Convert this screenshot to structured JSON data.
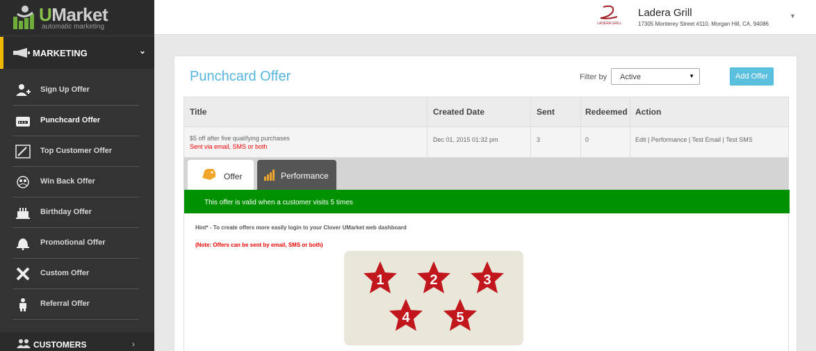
{
  "brand": {
    "letter": "U",
    "rest": "Market",
    "tagline": "automatic marketing"
  },
  "sidebar": {
    "section_label": "MARKETING",
    "items": [
      {
        "label": "Sign Up Offer",
        "icon": "add-user-icon"
      },
      {
        "label": "Punchcard Offer",
        "icon": "punchcard-icon"
      },
      {
        "label": "Top Customer Offer",
        "icon": "chart-icon"
      },
      {
        "label": "Win Back Offer",
        "icon": "group-icon"
      },
      {
        "label": "Birthday Offer",
        "icon": "cake-icon"
      },
      {
        "label": "Promotional Offer",
        "icon": "bell-icon"
      },
      {
        "label": "Custom Offer",
        "icon": "tools-icon"
      },
      {
        "label": "Referral Offer",
        "icon": "referral-icon"
      }
    ],
    "customers_label": "CUSTOMERS"
  },
  "header": {
    "store_name": "Ladera Grill",
    "store_address": "17305 Monterey Street #110, Morgan Hill, CA, 94086",
    "logo_text": "LADERA GRILL"
  },
  "panel": {
    "title": "Punchcard Offer",
    "filter_label": "Filter by",
    "filter_value": "Active",
    "add_button": "Add Offer"
  },
  "table": {
    "columns": [
      "Title",
      "Created Date",
      "Sent",
      "Redeemed",
      "Action"
    ],
    "rows": [
      {
        "title": "$5 off after five qualifying purchases",
        "subtitle": "Sent via email, SMS or both",
        "created": "Dec 01, 2015 01:32 pm",
        "sent": "3",
        "redeemed": "0",
        "action": "Edit | Performance | Test Email | Test SMS"
      }
    ]
  },
  "tabs": [
    {
      "label": "Offer"
    },
    {
      "label": "Performance"
    }
  ],
  "offer": {
    "valid_text": "This offer is valid when a customer visits 5 times",
    "hint": "Hint* - To create offers more easily login to your Clover UMarket web dashboard",
    "note": "(Note: Offers can be sent by email, SMS or both)",
    "stars": [
      "1",
      "2",
      "3",
      "4",
      "5"
    ]
  },
  "colors": {
    "sidebar_bg": "#333333",
    "accent_yellow": "#f1b800",
    "title_blue": "#55b6df",
    "button_blue": "#5bc0de",
    "valid_green": "#009100",
    "star_red": "#c0161c"
  }
}
